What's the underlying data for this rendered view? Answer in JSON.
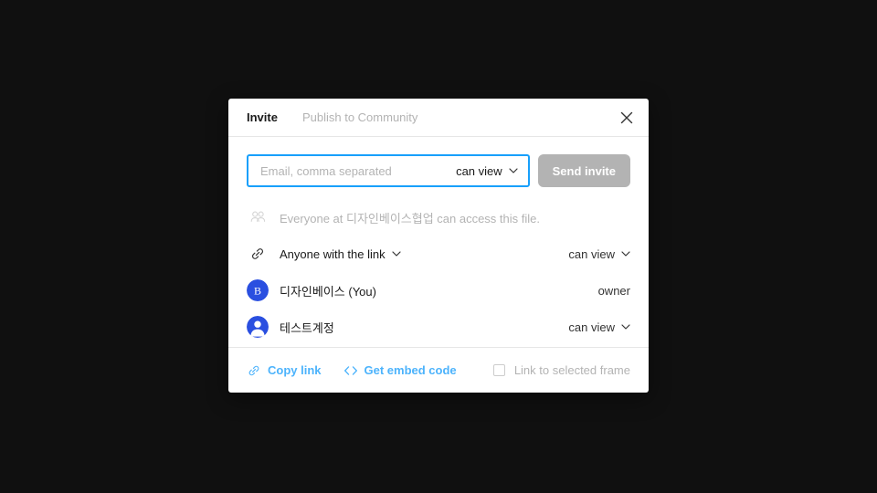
{
  "theme": {
    "backdrop": "#101010",
    "panel_bg": "#ffffff",
    "accent_blue": "#18a0fb",
    "link_blue": "#4cb3fc",
    "avatar_blue": "#2a4fe0",
    "muted_text": "#b3b3b3",
    "disabled_button": "#b3b3b3",
    "divider": "#e6e6e6"
  },
  "dialog": {
    "tabs": [
      {
        "label": "Invite",
        "active": true
      },
      {
        "label": "Publish to Community",
        "active": false
      }
    ],
    "close_icon": "close-icon"
  },
  "invite": {
    "email_placeholder": "Email, comma separated",
    "email_value": "",
    "permission": "can view",
    "permission_chevron": "chevron-down-icon",
    "send_label": "Send invite",
    "send_enabled": false
  },
  "rows": [
    {
      "icon": "people-icon",
      "label": "Everyone at 디자인베이스협업 can access this file.",
      "muted": true,
      "right": "",
      "right_has_chevron": false
    },
    {
      "icon": "link-icon",
      "label": "Anyone with the link",
      "muted": false,
      "label_has_chevron": true,
      "right": "can view",
      "right_has_chevron": true
    },
    {
      "icon": "avatar-initial",
      "avatar_initial": "B",
      "label": "디자인베이스 (You)",
      "muted": false,
      "right": "owner",
      "right_has_chevron": false
    },
    {
      "icon": "avatar-person",
      "label": "테스트계정",
      "muted": false,
      "right": "can view",
      "right_has_chevron": true
    }
  ],
  "footer": {
    "copy_link": {
      "icon": "link-icon",
      "label": "Copy link"
    },
    "embed": {
      "icon": "code-brackets-icon",
      "label": "Get embed code"
    },
    "frame_checkbox": {
      "label": "Link to selected frame",
      "checked": false
    }
  }
}
